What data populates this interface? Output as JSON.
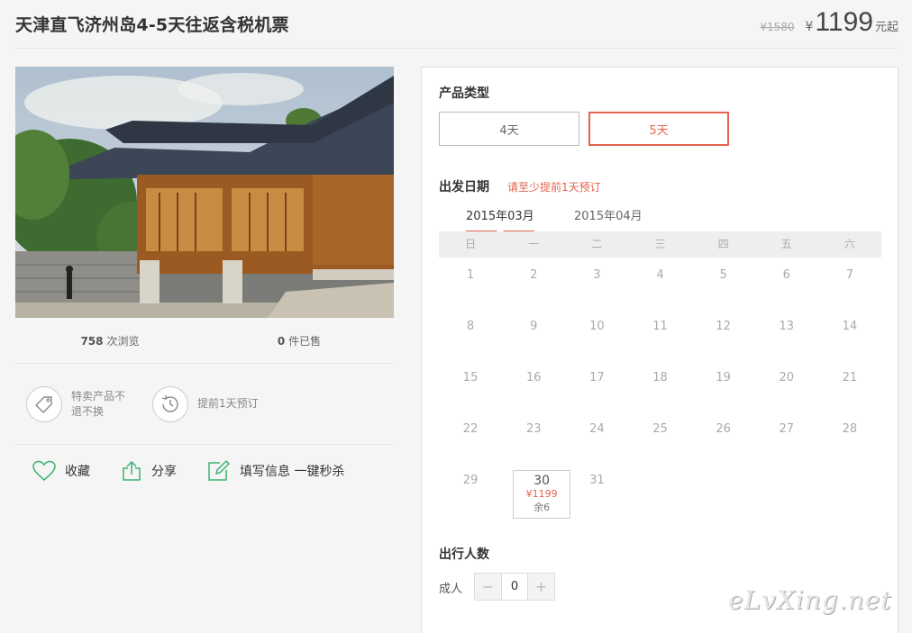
{
  "product": {
    "title": "天津直飞济州岛4-5天往返含税机票",
    "old_price": "¥1580",
    "currency": "¥",
    "price": "1199",
    "price_suffix": "元起"
  },
  "stats": {
    "views_count": "758",
    "views_label": "次浏览",
    "sold_count": "0",
    "sold_label": "件已售"
  },
  "features": [
    {
      "icon": "tag-icon",
      "text": "特卖产品不退不换"
    },
    {
      "icon": "clock-icon",
      "text": "提前1天预订"
    }
  ],
  "actions": [
    {
      "icon": "heart-icon",
      "label": "收藏"
    },
    {
      "icon": "share-icon",
      "label": "分享"
    },
    {
      "icon": "edit-icon",
      "label": "填写信息 一键秒杀"
    }
  ],
  "booking": {
    "type_label": "产品类型",
    "type_options": [
      "4天",
      "5天"
    ],
    "type_selected": "5天",
    "date_label": "出发日期",
    "date_hint": "请至少提前1天预订",
    "months": [
      "2015年03月",
      "2015年04月"
    ],
    "active_month": "2015年03月",
    "weekdays": [
      "日",
      "一",
      "二",
      "三",
      "四",
      "五",
      "六"
    ],
    "weeks": [
      [
        "1",
        "2",
        "3",
        "4",
        "5",
        "6",
        "7"
      ],
      [
        "8",
        "9",
        "10",
        "11",
        "12",
        "13",
        "14"
      ],
      [
        "15",
        "16",
        "17",
        "18",
        "19",
        "20",
        "21"
      ],
      [
        "22",
        "23",
        "24",
        "25",
        "26",
        "27",
        "28"
      ],
      [
        "29",
        "30",
        "31",
        "",
        "",
        "",
        ""
      ]
    ],
    "available_day": {
      "day": "30",
      "price": "¥1199",
      "remaining": "余6"
    },
    "travelers_label": "出行人数",
    "adult_label": "成人",
    "adult_count": "0",
    "minus": "−",
    "plus": "+"
  },
  "watermark": "eLvXing.net",
  "colors": {
    "accent": "#e4634f",
    "green_icon": "#3cb371"
  }
}
